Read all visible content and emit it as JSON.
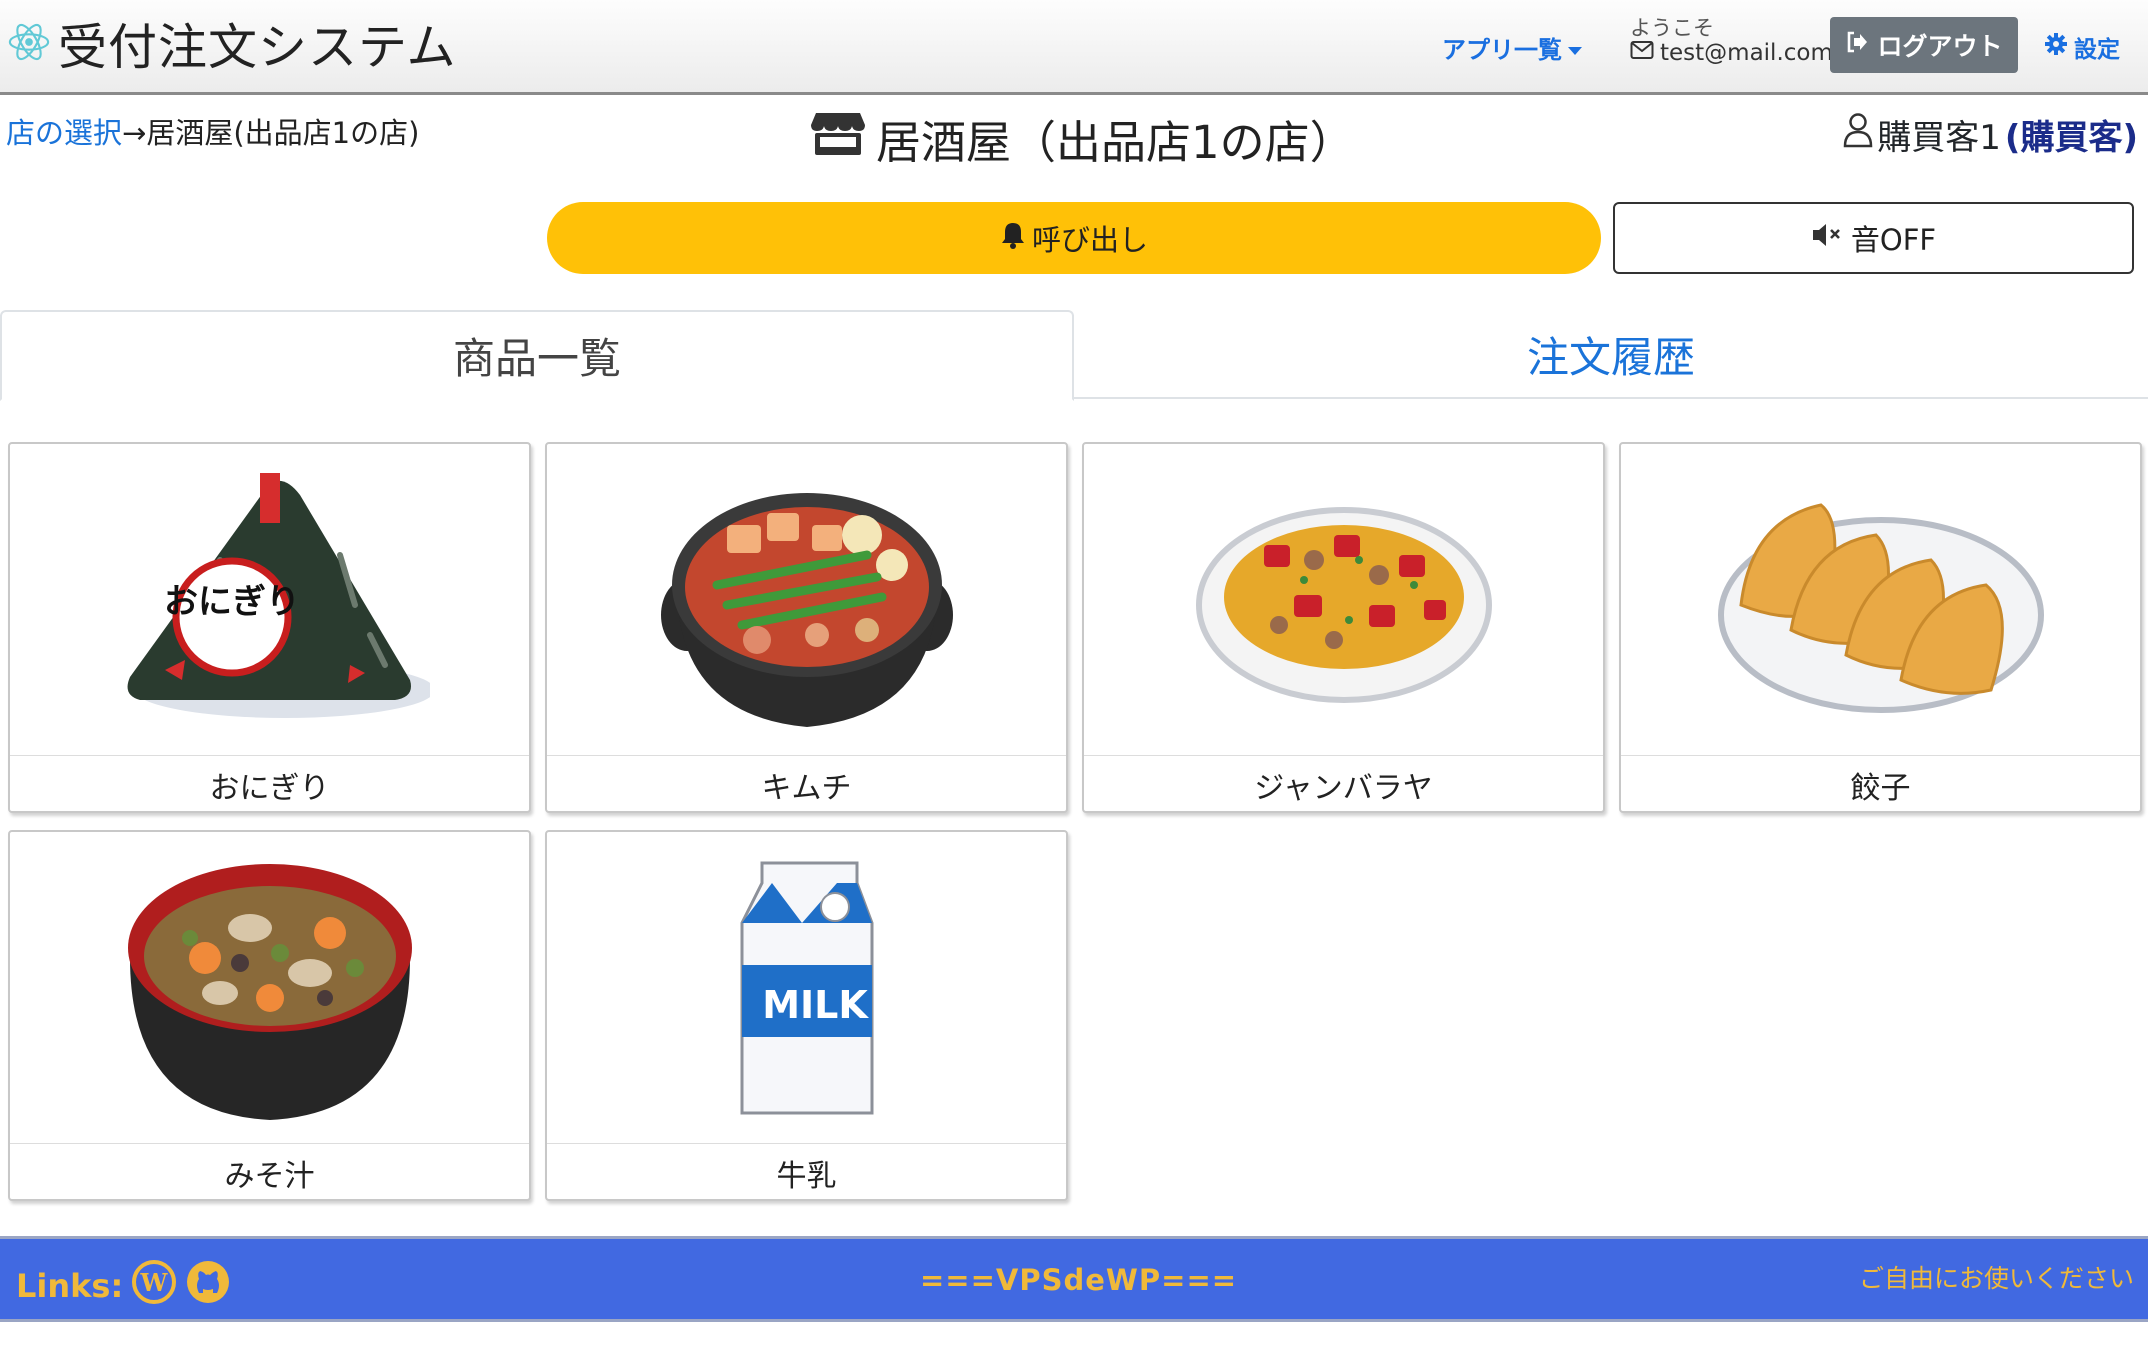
{
  "navbar": {
    "app_title": "受付注文システム",
    "app_list_label": "アプリ一覧",
    "welcome": "ようこそ",
    "email": "test@mail.com",
    "logout_label": "ログアウト",
    "settings_label": "設定"
  },
  "header": {
    "breadcrumb_link": "店の選択",
    "breadcrumb_current": "→居酒屋(出品店1の店)",
    "shop_title": "居酒屋（出品店1の店）",
    "user_name": "購買客1",
    "user_role": "(購買客)"
  },
  "actions": {
    "call_label": "呼び出し",
    "sound_label": "音OFF"
  },
  "tabs": {
    "products": "商品一覧",
    "history": "注文履歴"
  },
  "products": [
    {
      "name": "おにぎり",
      "icon": "onigiri-image"
    },
    {
      "name": "キムチ",
      "icon": "kimchi-nabe-image"
    },
    {
      "name": "ジャンバラヤ",
      "icon": "jambalaya-image"
    },
    {
      "name": "餃子",
      "icon": "gyoza-image"
    },
    {
      "name": "みそ汁",
      "icon": "miso-soup-image"
    },
    {
      "name": "牛乳",
      "icon": "milk-carton-image"
    }
  ],
  "product_image_text": {
    "onigiri_label": "おにぎり",
    "milk_label": "MILK"
  },
  "footer": {
    "links_label": "Links:",
    "center_text": "===VPSdeWP===",
    "right_text": "ご自由にお使いください"
  },
  "colors": {
    "call_button": "#ffc107",
    "footer_bg": "#4169e1",
    "footer_text": "#f0b93a",
    "link": "#1a73d9"
  }
}
